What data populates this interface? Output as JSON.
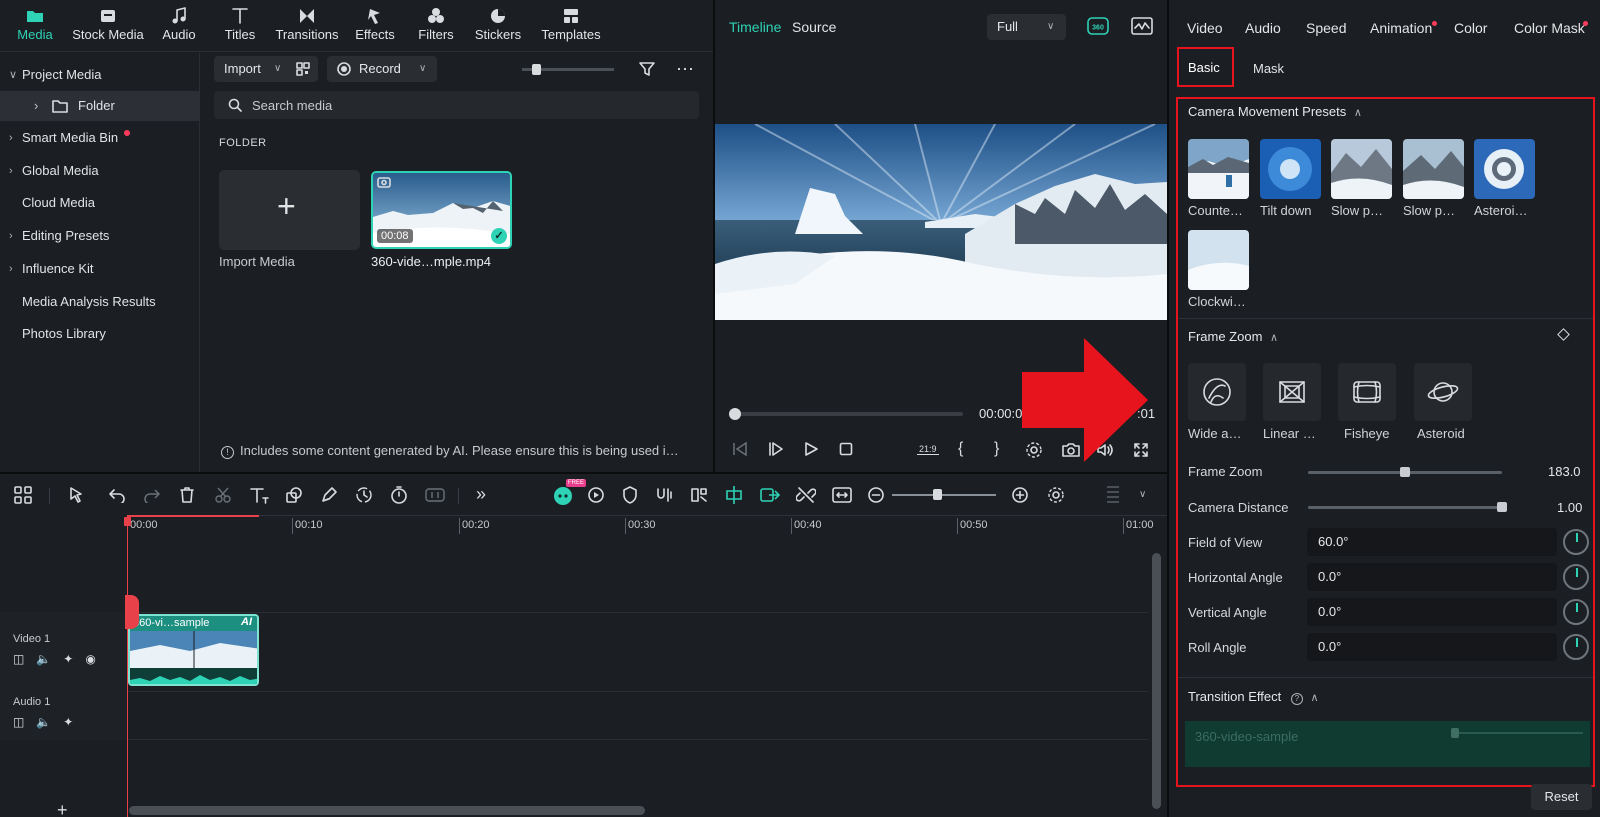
{
  "top_tabs": [
    {
      "label": "Media",
      "icon": "folder-icon",
      "active": true
    },
    {
      "label": "Stock Media",
      "icon": "stock-icon"
    },
    {
      "label": "Audio",
      "icon": "music-icon"
    },
    {
      "label": "Titles",
      "icon": "titles-icon"
    },
    {
      "label": "Transitions",
      "icon": "transitions-icon"
    },
    {
      "label": "Effects",
      "icon": "effects-icon"
    },
    {
      "label": "Filters",
      "icon": "filters-icon"
    },
    {
      "label": "Stickers",
      "icon": "stickers-icon"
    },
    {
      "label": "Templates",
      "icon": "templates-icon"
    }
  ],
  "sidebar": {
    "project_media": "Project Media",
    "folder": "Folder",
    "items": [
      "Smart Media Bin",
      "Global Media",
      "Cloud Media",
      "Editing Presets",
      "Influence Kit",
      "Media Analysis Results",
      "Photos Library"
    ]
  },
  "media": {
    "import_label": "Import",
    "record_label": "Record",
    "search_placeholder": "Search media",
    "folder_heading": "FOLDER",
    "import_media": "Import Media",
    "clip_duration": "00:08",
    "clip_name": "360-vide…mple.mp4",
    "ai_notice": "Includes some content generated by AI. Please ensure this is being used i…"
  },
  "preview": {
    "tab_timeline": "Timeline",
    "tab_source": "Source",
    "quality": "Full",
    "time_current": "00:00:0",
    "time_end": ":01",
    "aspect": "21:9"
  },
  "props": {
    "tabs": [
      "Video",
      "Audio",
      "Speed",
      "Animation",
      "Color",
      "Color Mask"
    ],
    "subtabs": [
      "Basic",
      "Mask"
    ],
    "camera_presets_title": "Camera Movement Presets",
    "presets": [
      "Counte…",
      "Tilt down",
      "Slow p…",
      "Slow p…",
      "Asteroi…",
      "Clockwi…"
    ],
    "frame_zoom_title": "Frame Zoom",
    "zoom_types": [
      "Wide a…",
      "Linear …",
      "Fisheye",
      "Asteroid"
    ],
    "frame_zoom_label": "Frame Zoom",
    "frame_zoom_value": "183.0",
    "frame_zoom_level": 0.5,
    "camera_distance_label": "Camera Distance",
    "camera_distance_value": "1.00",
    "camera_distance_level": 1.0,
    "fov_label": "Field of View",
    "fov_value": "60.0°",
    "hangle_label": "Horizontal Angle",
    "hangle_value": "0.0°",
    "vangle_label": "Vertical Angle",
    "vangle_value": "0.0°",
    "roll_label": "Roll Angle",
    "roll_value": "0.0°",
    "transition_title": "Transition Effect",
    "transition_clip": "360-video-sample",
    "reset_label": "Reset"
  },
  "timeline": {
    "ticks": [
      "00:00",
      "00:10",
      "00:20",
      "00:30",
      "00:40",
      "00:50",
      "01:00"
    ],
    "video_track": "Video 1",
    "audio_track": "Audio 1",
    "clip_label": "360-vi…sample",
    "clip_badge": "AI",
    "free_badge": "FREE"
  },
  "colors": {
    "accent": "#2ed3b6",
    "annotation": "#e8141d",
    "bg": "#1b1e22"
  }
}
